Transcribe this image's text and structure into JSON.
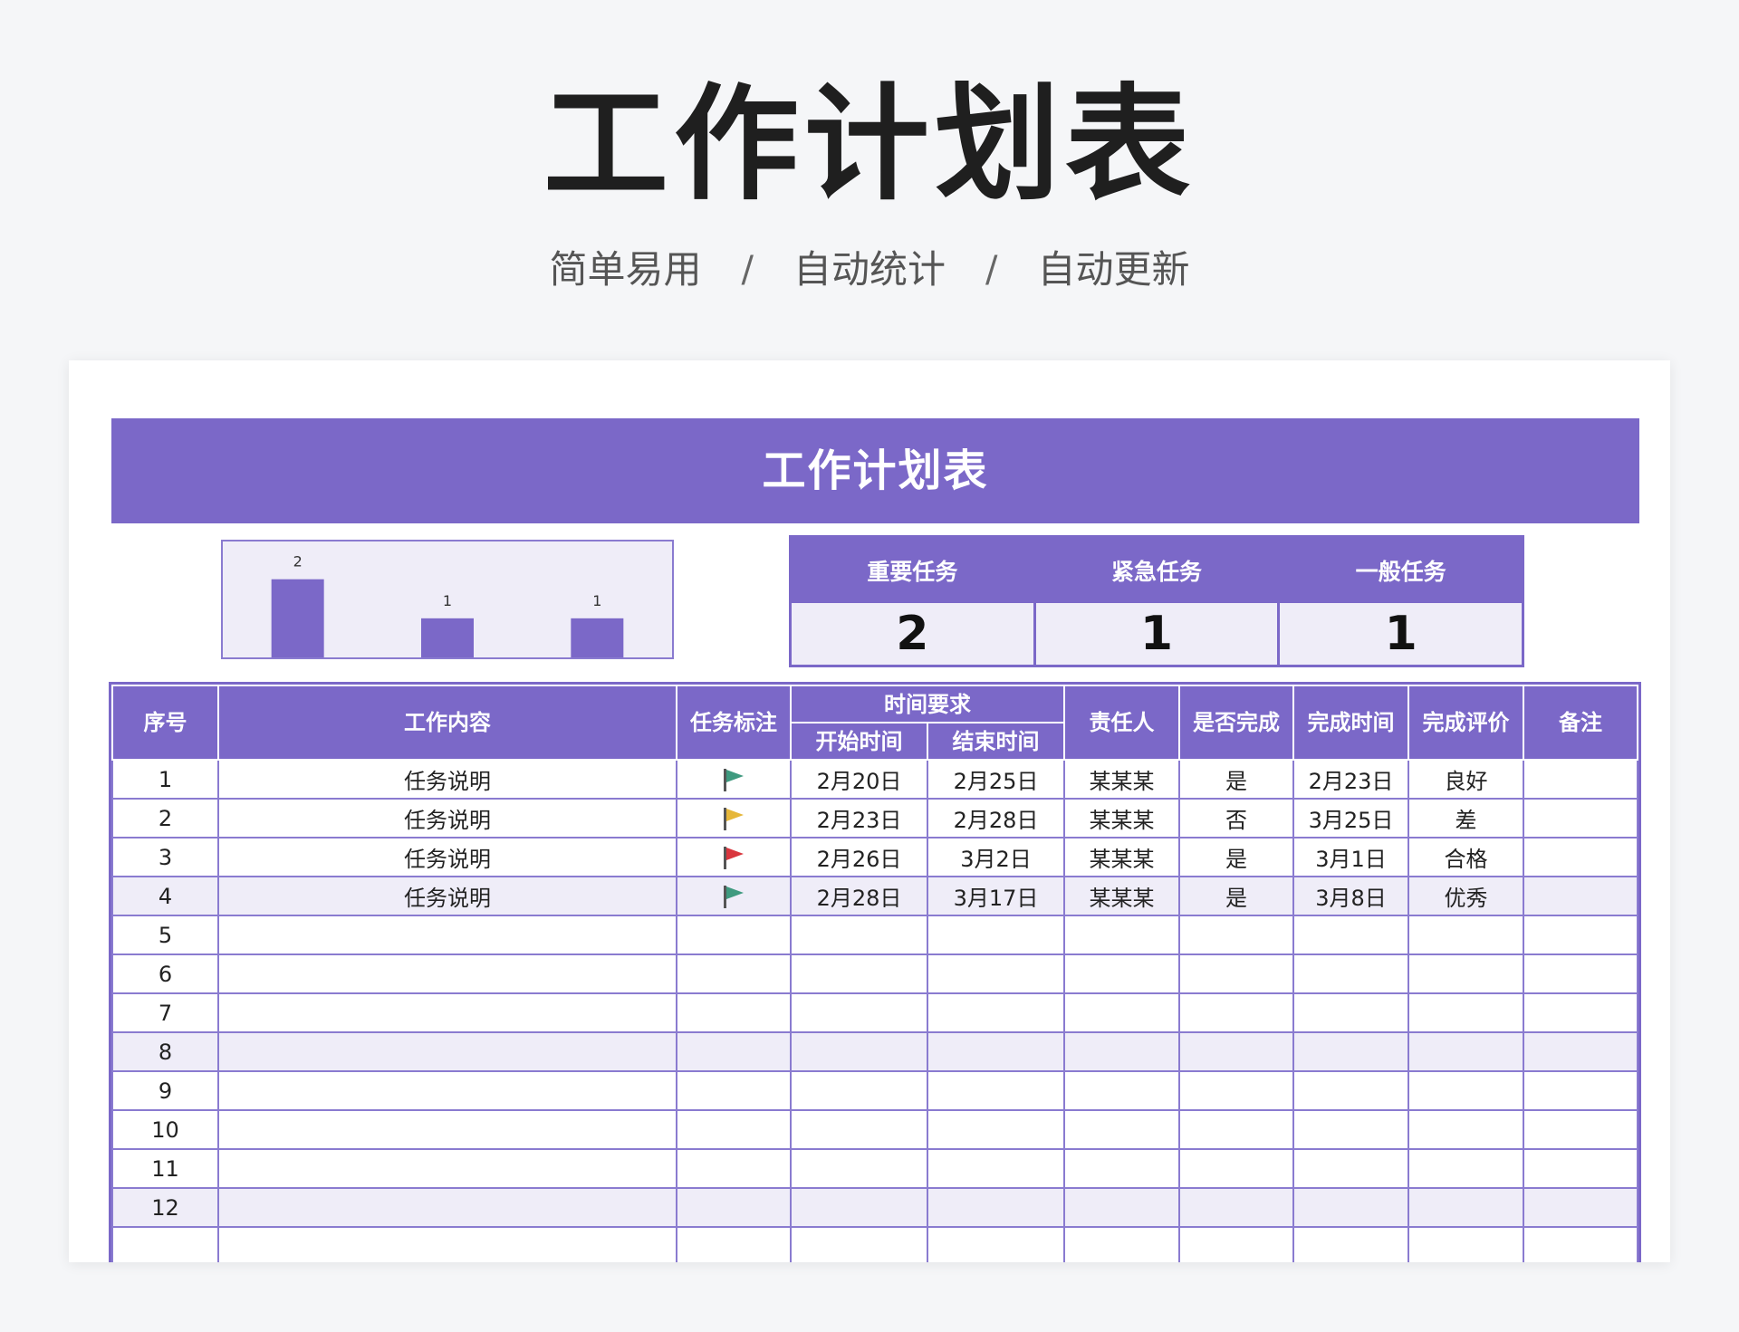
{
  "hero": {
    "title": "工作计划表",
    "subtitle": [
      "简单易用",
      "自动统计",
      "自动更新"
    ],
    "separator": "/"
  },
  "sheet": {
    "banner_title": "工作计划表"
  },
  "chart_data": {
    "type": "bar",
    "categories": [
      "重要任务",
      "紧急任务",
      "一般任务"
    ],
    "values": [
      2,
      1,
      1
    ],
    "ylim": [
      0,
      2.6
    ],
    "bar_color": "#7b68c8",
    "background": "#efedf8",
    "grid": false,
    "legend": "none",
    "data_labels": true
  },
  "stats": [
    {
      "label": "重要任务",
      "value": "2"
    },
    {
      "label": "紧急任务",
      "value": "1"
    },
    {
      "label": "一般任务",
      "value": "1"
    }
  ],
  "table": {
    "headers": {
      "index": "序号",
      "content": "工作内容",
      "flag": "任务标注",
      "time_group": "时间要求",
      "start": "开始时间",
      "end": "结束时间",
      "owner": "责任人",
      "done": "是否完成",
      "finish_time": "完成时间",
      "rating": "完成评价",
      "note": "备注"
    },
    "rows": [
      {
        "index": "1",
        "content": "任务说明",
        "flag": "green",
        "start": "2月20日",
        "end": "2月25日",
        "owner": "某某某",
        "done": "是",
        "finish_time": "2月23日",
        "rating": "良好",
        "note": ""
      },
      {
        "index": "2",
        "content": "任务说明",
        "flag": "yellow",
        "start": "2月23日",
        "end": "2月28日",
        "owner": "某某某",
        "done": "否",
        "finish_time": "3月25日",
        "rating": "差",
        "note": ""
      },
      {
        "index": "3",
        "content": "任务说明",
        "flag": "red",
        "start": "2月26日",
        "end": "3月2日",
        "owner": "某某某",
        "done": "是",
        "finish_time": "3月1日",
        "rating": "合格",
        "note": ""
      },
      {
        "index": "4",
        "content": "任务说明",
        "flag": "green",
        "start": "2月28日",
        "end": "3月17日",
        "owner": "某某某",
        "done": "是",
        "finish_time": "3月8日",
        "rating": "优秀",
        "note": ""
      },
      {
        "index": "5",
        "content": "",
        "flag": "",
        "start": "",
        "end": "",
        "owner": "",
        "done": "",
        "finish_time": "",
        "rating": "",
        "note": ""
      },
      {
        "index": "6",
        "content": "",
        "flag": "",
        "start": "",
        "end": "",
        "owner": "",
        "done": "",
        "finish_time": "",
        "rating": "",
        "note": ""
      },
      {
        "index": "7",
        "content": "",
        "flag": "",
        "start": "",
        "end": "",
        "owner": "",
        "done": "",
        "finish_time": "",
        "rating": "",
        "note": ""
      },
      {
        "index": "8",
        "content": "",
        "flag": "",
        "start": "",
        "end": "",
        "owner": "",
        "done": "",
        "finish_time": "",
        "rating": "",
        "note": ""
      },
      {
        "index": "9",
        "content": "",
        "flag": "",
        "start": "",
        "end": "",
        "owner": "",
        "done": "",
        "finish_time": "",
        "rating": "",
        "note": ""
      },
      {
        "index": "10",
        "content": "",
        "flag": "",
        "start": "",
        "end": "",
        "owner": "",
        "done": "",
        "finish_time": "",
        "rating": "",
        "note": ""
      },
      {
        "index": "11",
        "content": "",
        "flag": "",
        "start": "",
        "end": "",
        "owner": "",
        "done": "",
        "finish_time": "",
        "rating": "",
        "note": ""
      },
      {
        "index": "12",
        "content": "",
        "flag": "",
        "start": "",
        "end": "",
        "owner": "",
        "done": "",
        "finish_time": "",
        "rating": "",
        "note": ""
      },
      {
        "index": "",
        "content": "",
        "flag": "",
        "start": "",
        "end": "",
        "owner": "",
        "done": "",
        "finish_time": "",
        "rating": "",
        "note": ""
      }
    ],
    "alt_rows": [
      4,
      8,
      12
    ]
  },
  "colors": {
    "accent": "#7b68c8",
    "light": "#efedf8",
    "flag_green": "#3f9a7f",
    "flag_yellow": "#e6b73a",
    "flag_red": "#d9363e",
    "flag_pole": "#555555"
  }
}
